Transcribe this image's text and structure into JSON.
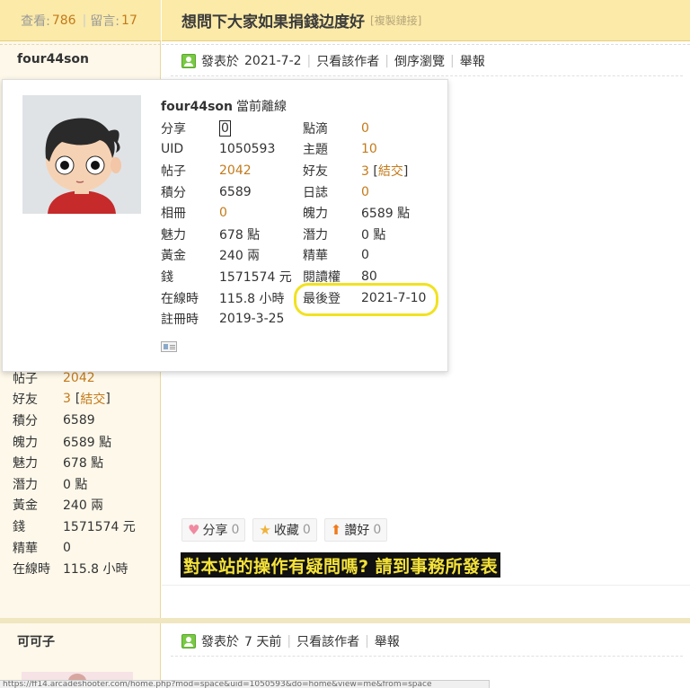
{
  "header": {
    "views_label": "查看:",
    "views": "786",
    "replies_label": "留言:",
    "replies": "17",
    "title": "想問下大家如果捐錢边度好",
    "copy_link": "[複製鏈接]"
  },
  "post1": {
    "author": "four44son",
    "posted_label": "發表於",
    "posted_date": "2021-7-2",
    "links": [
      "只看該作者",
      "倒序瀏覽",
      "舉報"
    ]
  },
  "popup": {
    "name": "four44son",
    "status": "當前離線",
    "rows": [
      {
        "l1": "分享",
        "v1": "0",
        "l2": "點滴",
        "v2": "0"
      },
      {
        "l1": "UID",
        "v1": "1050593",
        "l2": "主題",
        "v2": "10"
      },
      {
        "l1": "帖子",
        "v1": "2042",
        "l2": "好友",
        "v2": "3",
        "v2_extra": "結交"
      },
      {
        "l1": "積分",
        "v1": "6589",
        "l2": "日誌",
        "v2": "0"
      },
      {
        "l1": "相冊",
        "v1": "0",
        "l2": "魄力",
        "v2": "6589 點"
      },
      {
        "l1": "魅力",
        "v1": "678 點",
        "l2": "潛力",
        "v2": "0 點"
      },
      {
        "l1": "黃金",
        "v1": "240 兩",
        "l2": "精華",
        "v2": "0"
      },
      {
        "l1": "錢",
        "v1": "1571574 元",
        "l2": "閱讀權",
        "v2": "80"
      },
      {
        "l1": "在線時",
        "v1": "115.8 小時",
        "l2": "最後登",
        "v2": "2021-7-10"
      },
      {
        "l1": "註冊時",
        "v1": "2019-3-25",
        "l2": "",
        "v2": ""
      }
    ]
  },
  "sidebar_stats": [
    {
      "label": "帖子",
      "value": "2042"
    },
    {
      "label": "好友",
      "value": "3",
      "extra": "結交"
    },
    {
      "label": "積分",
      "value": "6589"
    },
    {
      "label": "魄力",
      "value": "6589 點"
    },
    {
      "label": "魅力",
      "value": "678 點"
    },
    {
      "label": "潛力",
      "value": "0 點"
    },
    {
      "label": "黃金",
      "value": "240 兩"
    },
    {
      "label": "錢",
      "value": "1571574 元"
    },
    {
      "label": "精華",
      "value": "0"
    },
    {
      "label": "在線時",
      "value": "115.8 小時"
    }
  ],
  "actions": {
    "share_label": "分享",
    "share_count": "0",
    "fav_label": "收藏",
    "fav_count": "0",
    "like_label": "讚好",
    "like_count": "0"
  },
  "banner": "對本站的操作有疑問嗎? 請到事務所發表",
  "post2": {
    "author": "可可子",
    "posted_label": "發表於",
    "posted_date": "7 天前",
    "links": [
      "只看該作者",
      "舉報"
    ]
  },
  "status_url": "https://ff14.arcadeshooter.com/home.php?mod=space&uid=1050593&do=home&view=me&from=space"
}
